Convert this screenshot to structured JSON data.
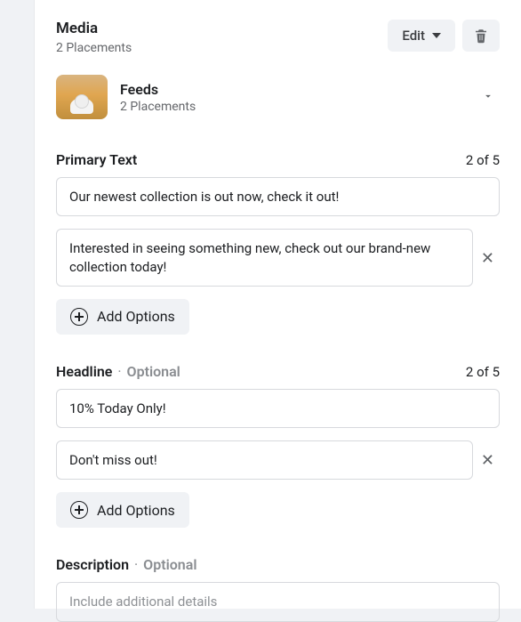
{
  "media": {
    "title": "Media",
    "placements": "2 Placements",
    "edit_label": "Edit"
  },
  "feeds": {
    "title": "Feeds",
    "placements": "2 Placements"
  },
  "primary_text": {
    "label": "Primary Text",
    "counter": "2 of 5",
    "options": [
      "Our newest collection is out now, check it out!",
      "Interested in seeing something new, check out our brand-new collection today!"
    ],
    "add_label": "Add Options"
  },
  "headline": {
    "label": "Headline",
    "optional": "Optional",
    "counter": "2 of 5",
    "options": [
      "10% Today Only!",
      "Don't miss out!"
    ],
    "add_label": "Add Options"
  },
  "description": {
    "label": "Description",
    "optional": "Optional",
    "placeholder": "Include additional details"
  }
}
